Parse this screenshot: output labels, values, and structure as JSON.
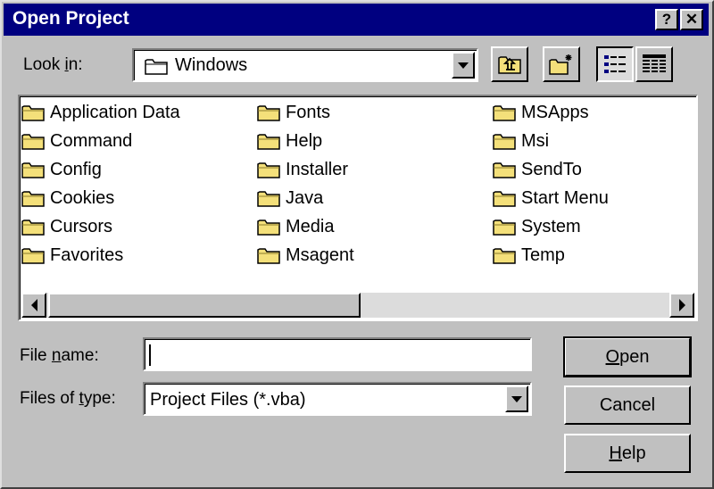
{
  "window": {
    "title": "Open Project",
    "help_glyph": "?",
    "close_glyph": "✕"
  },
  "lookin": {
    "label_pre": "Look ",
    "label_ul": "i",
    "label_post": "n:",
    "value": "Windows"
  },
  "toolbar": {
    "icons": [
      "up-one-level-icon",
      "create-new-folder-icon",
      "list-view-icon",
      "details-view-icon"
    ]
  },
  "files": [
    "Application Data",
    "Command",
    "Config",
    "Cookies",
    "Cursors",
    "Favorites",
    "Fonts",
    "Help",
    "Installer",
    "Java",
    "Media",
    "Msagent",
    "MSApps",
    "Msi",
    "SendTo",
    "Start Menu",
    "System",
    "Temp"
  ],
  "filename": {
    "label_pre": "File ",
    "label_ul": "n",
    "label_post": "ame:",
    "value": ""
  },
  "filetype": {
    "label_pre": "Files of ",
    "label_ul": "t",
    "label_post": "ype:",
    "value": "Project Files (*.vba)"
  },
  "buttons": {
    "open": {
      "ul": "O",
      "rest": "pen"
    },
    "cancel": {
      "label": "Cancel"
    },
    "help": {
      "ul": "H",
      "rest": "elp"
    }
  },
  "colors": {
    "titlebar": "#000080",
    "face": "#c0c0c0",
    "folder": "#f4e07a"
  }
}
